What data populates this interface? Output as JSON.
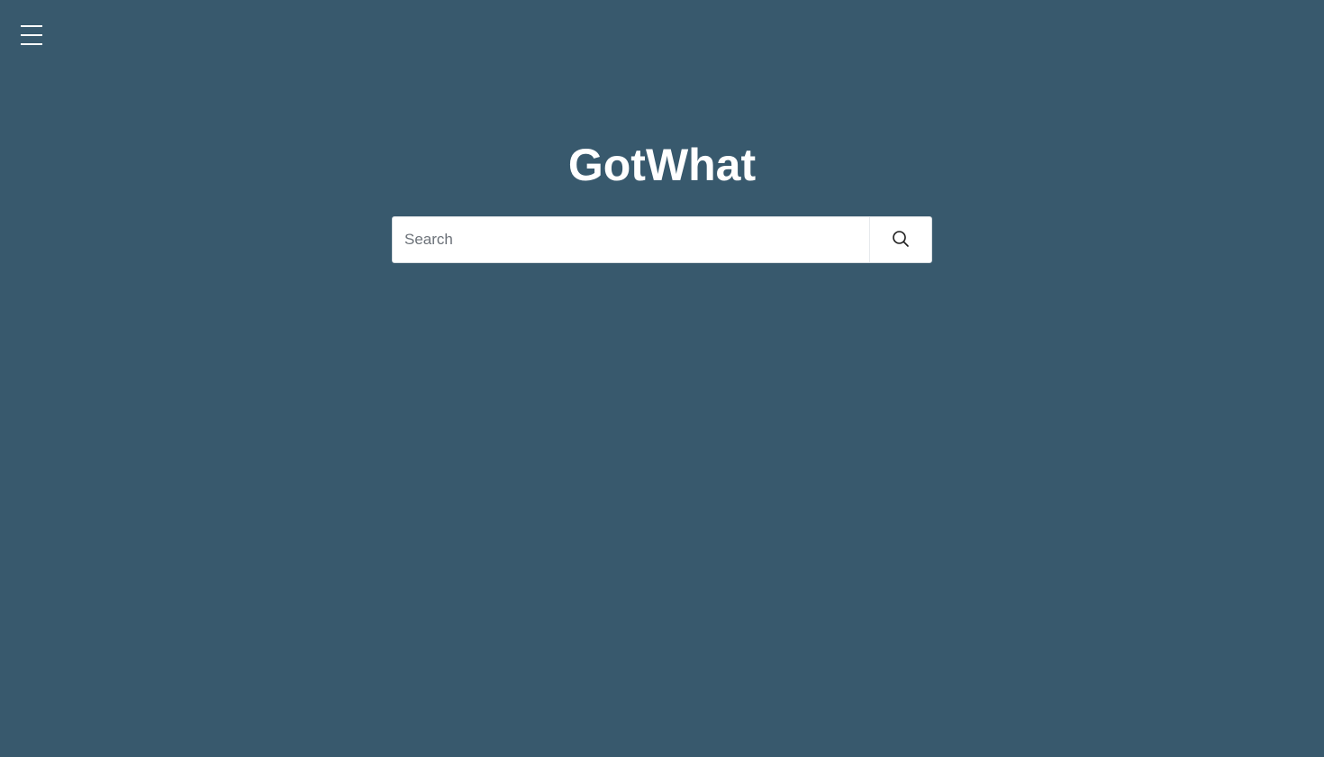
{
  "header": {
    "menu_icon": "hamburger-menu-icon"
  },
  "brand": {
    "title": "GotWhat"
  },
  "search": {
    "placeholder": "Search",
    "value": "",
    "button_icon": "search-icon"
  },
  "colors": {
    "background": "#38596d",
    "title": "#ffffff",
    "search_bg": "#ffffff"
  }
}
